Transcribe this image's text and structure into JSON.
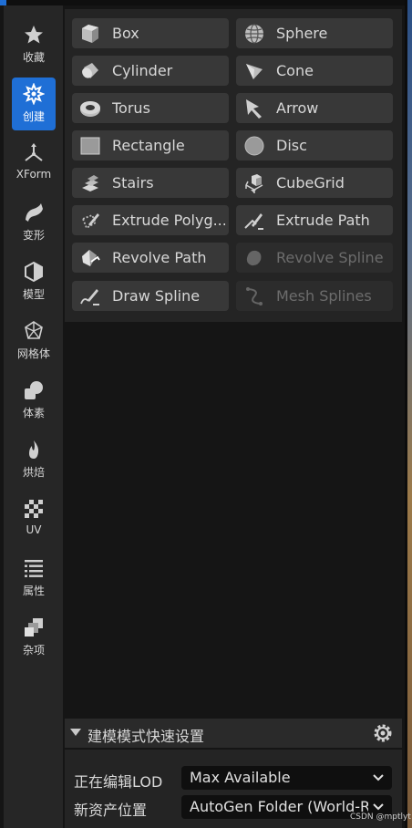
{
  "sidebar": {
    "items": [
      {
        "label": "收藏",
        "icon": "star-icon"
      },
      {
        "label": "创建",
        "icon": "create-icon",
        "active": true
      },
      {
        "label": "XForm",
        "icon": "xform-icon"
      },
      {
        "label": "变形",
        "icon": "deform-icon"
      },
      {
        "label": "模型",
        "icon": "model-icon"
      },
      {
        "label": "网格体",
        "icon": "mesh-icon"
      },
      {
        "label": "体素",
        "icon": "voxel-icon"
      },
      {
        "label": "烘焙",
        "icon": "bake-icon"
      },
      {
        "label": "UV",
        "icon": "uv-icon"
      },
      {
        "label": "属性",
        "icon": "attributes-icon"
      },
      {
        "label": "杂项",
        "icon": "misc-icon"
      }
    ]
  },
  "tools": [
    {
      "label": "Box",
      "icon": "box-icon"
    },
    {
      "label": "Sphere",
      "icon": "sphere-icon"
    },
    {
      "label": "Cylinder",
      "icon": "cylinder-icon"
    },
    {
      "label": "Cone",
      "icon": "cone-icon"
    },
    {
      "label": "Torus",
      "icon": "torus-icon"
    },
    {
      "label": "Arrow",
      "icon": "arrow-icon"
    },
    {
      "label": "Rectangle",
      "icon": "rectangle-icon"
    },
    {
      "label": "Disc",
      "icon": "disc-icon"
    },
    {
      "label": "Stairs",
      "icon": "stairs-icon"
    },
    {
      "label": "CubeGrid",
      "icon": "cubegrid-icon"
    },
    {
      "label": "Extrude Polyg...",
      "icon": "extrude-polygon-icon"
    },
    {
      "label": "Extrude Path",
      "icon": "extrude-path-icon"
    },
    {
      "label": "Revolve Path",
      "icon": "revolve-path-icon"
    },
    {
      "label": "Revolve Spline",
      "icon": "revolve-spline-icon",
      "disabled": true
    },
    {
      "label": "Draw Spline",
      "icon": "draw-spline-icon"
    },
    {
      "label": "Mesh Splines",
      "icon": "mesh-splines-icon",
      "disabled": true
    }
  ],
  "quick_settings": {
    "title": "建模模式快速设置",
    "lod_label": "正在编辑LOD",
    "lod_value": "Max Available",
    "asset_label": "新资产位置",
    "asset_value": "AutoGen Folder (World-Relative)"
  },
  "watermark": "CSDN @mptlyt",
  "colors": {
    "accent": "#1f6fd6",
    "panel": "#242424",
    "button": "#383838"
  }
}
